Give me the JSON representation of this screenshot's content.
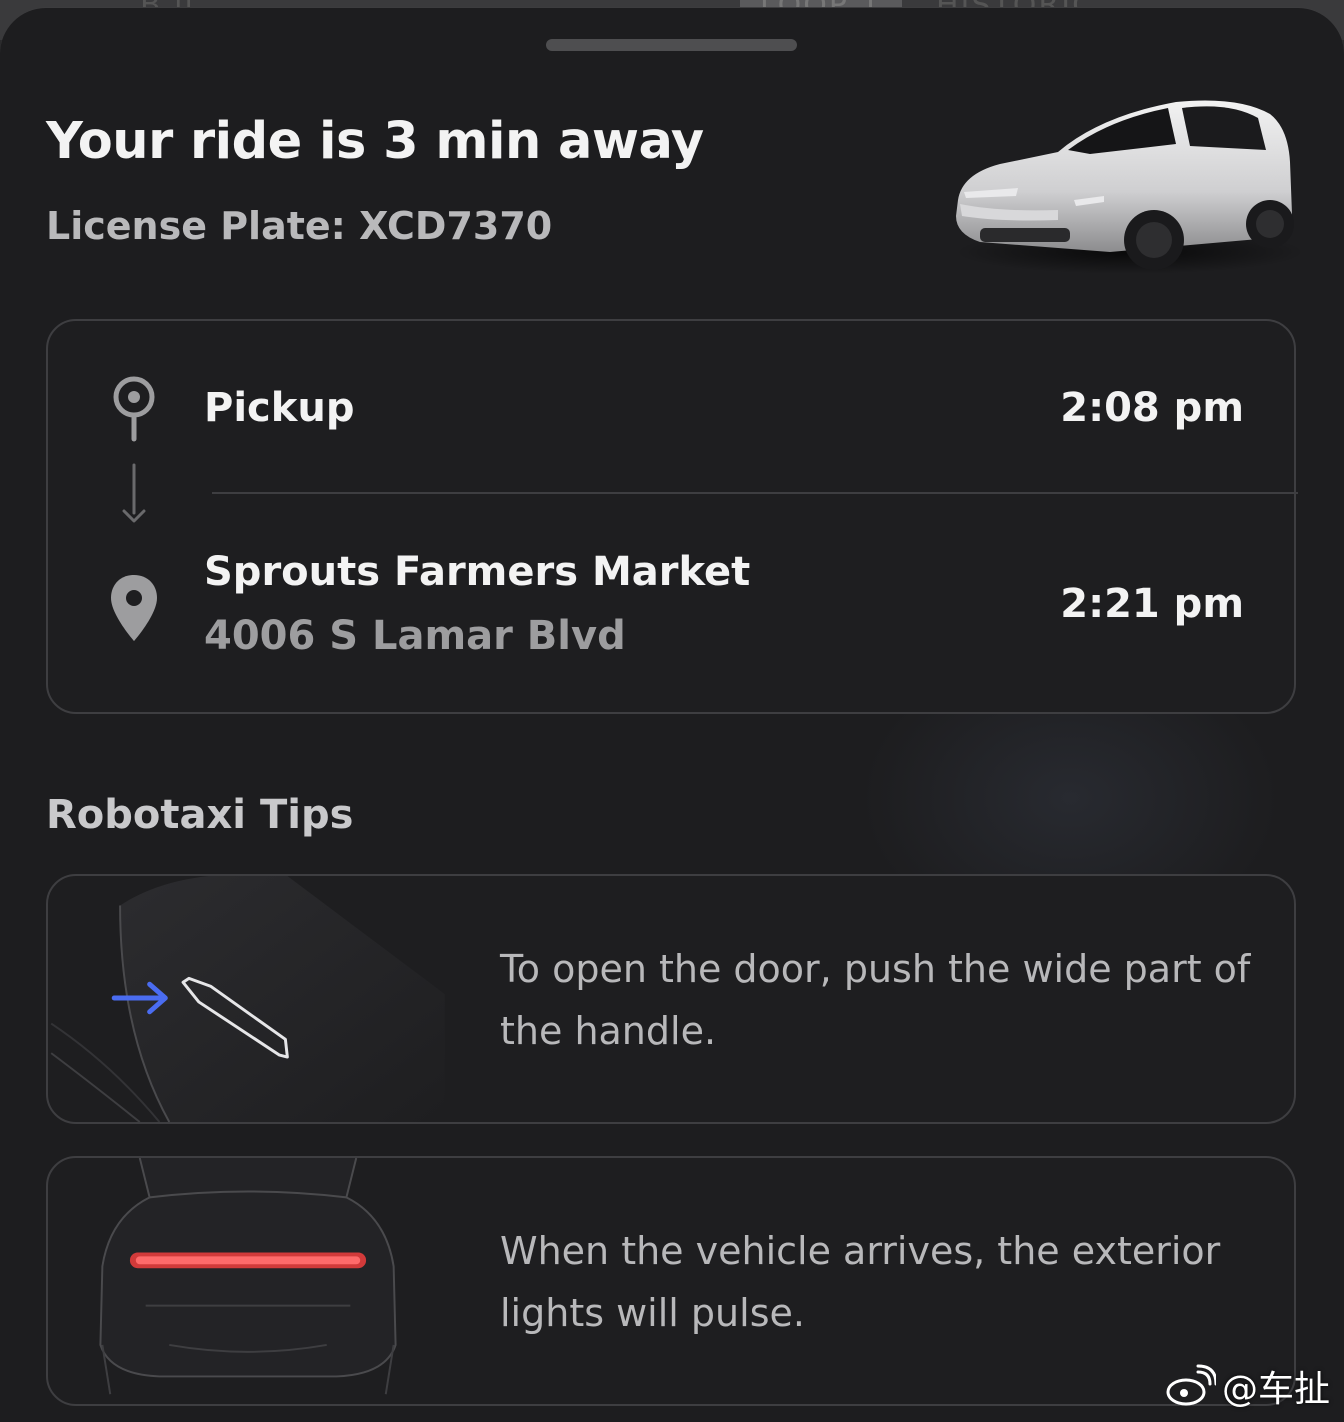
{
  "ride": {
    "title": "Your ride is 3 min away",
    "plate": "License Plate: XCD7370"
  },
  "trip": {
    "pickup": {
      "label": "Pickup",
      "time": "2:08 pm",
      "icon": "pickup-pin-icon"
    },
    "destination": {
      "name": "Sprouts Farmers Market",
      "address": "4006 S Lamar Blvd",
      "time": "2:21 pm",
      "icon": "destination-marker-icon"
    }
  },
  "tips": {
    "heading": "Robotaxi Tips",
    "items": [
      {
        "text": "To open the door, push the wide part of the handle.",
        "icon": "door-handle-illustration"
      },
      {
        "text": "When the vehicle arrives, the exterior lights will pulse.",
        "icon": "rear-lights-illustration"
      }
    ]
  },
  "watermark": {
    "text": "@车扯",
    "icon": "weibo-icon"
  },
  "colors": {
    "background": "#1d1d1f",
    "card_border": "#3e3e41",
    "primary_text": "#f3f3f3",
    "secondary_text": "#9d9d9f",
    "accent_arrow": "#4a6cf0",
    "tail_light": "#d23a3a"
  }
}
